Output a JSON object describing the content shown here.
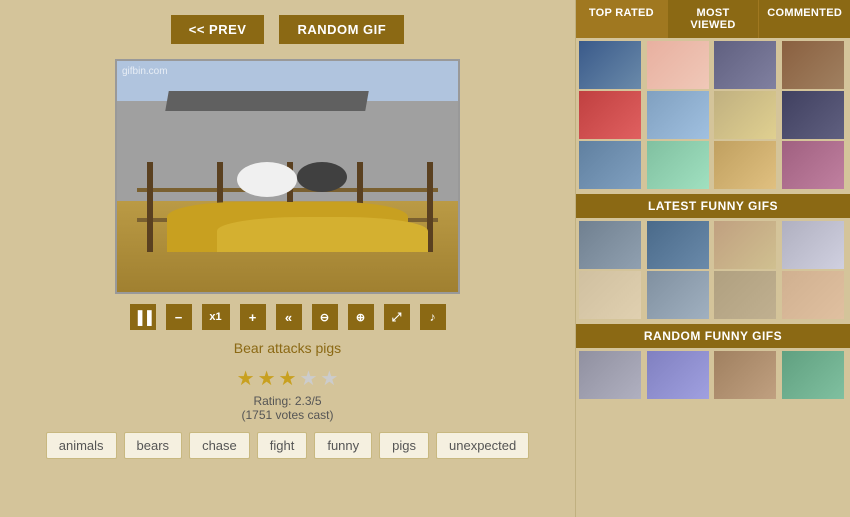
{
  "header": {
    "prev_label": "<< PREV",
    "random_label": "RANDOM GIF"
  },
  "gif": {
    "title": "Bear attacks pigs",
    "watermark": "gifbin.com",
    "rating": "Rating: 2.3/5",
    "votes": "(1751 votes cast)",
    "stars": [
      1,
      1,
      0.5,
      0,
      0
    ]
  },
  "controls": {
    "pause": "⏸",
    "minus": "−",
    "x1": "x1",
    "plus": "+",
    "rewind": "«",
    "zoom_out": "🔍",
    "zoom_in": "🔍",
    "expand": "⤢",
    "volume": "🔊"
  },
  "tags": [
    "animals",
    "bears",
    "chase",
    "fight",
    "funny",
    "pigs",
    "unexpected"
  ],
  "sidebar": {
    "tabs": [
      {
        "id": "top-rated",
        "label": "TOP RATED",
        "active": true
      },
      {
        "id": "most-viewed",
        "label": "MOST VIEWED",
        "active": false
      },
      {
        "id": "commented",
        "label": "COMMENTED",
        "active": false
      }
    ],
    "sections": [
      {
        "id": "latest",
        "label": "LATEST FUNNY GIFS"
      },
      {
        "id": "random",
        "label": "RANDOM FUNNY GIFS"
      }
    ]
  },
  "thumbs": {
    "top_rated": [
      {
        "color": "#3a5a8a",
        "alt": "thumb1"
      },
      {
        "color": "#e8b0a0",
        "alt": "thumb2"
      },
      {
        "color": "#606080",
        "alt": "thumb3"
      },
      {
        "color": "#8a6040",
        "alt": "thumb4"
      },
      {
        "color": "#c04040",
        "alt": "thumb5"
      },
      {
        "color": "#80a0c0",
        "alt": "thumb6"
      },
      {
        "color": "#c0b080",
        "alt": "thumb7"
      },
      {
        "color": "#404060",
        "alt": "thumb8"
      },
      {
        "color": "#6080a0",
        "alt": "thumb9"
      },
      {
        "color": "#80c0a0",
        "alt": "thumb10"
      },
      {
        "color": "#c0a060",
        "alt": "thumb11"
      },
      {
        "color": "#a06080",
        "alt": "thumb12"
      }
    ],
    "latest": [
      {
        "color": "#708090",
        "alt": "l1"
      },
      {
        "color": "#4a6a8a",
        "alt": "l2"
      },
      {
        "color": "#c0a080",
        "alt": "l3"
      },
      {
        "color": "#c0c0c0",
        "alt": "l4"
      },
      {
        "color": "#d0c0a0",
        "alt": "l5"
      },
      {
        "color": "#8090a0",
        "alt": "l6"
      },
      {
        "color": "#b0a080",
        "alt": "l7"
      },
      {
        "color": "#d0b090",
        "alt": "l8"
      }
    ],
    "random": [
      {
        "color": "#9090a0",
        "alt": "r1"
      },
      {
        "color": "#8080c0",
        "alt": "r2"
      }
    ]
  }
}
